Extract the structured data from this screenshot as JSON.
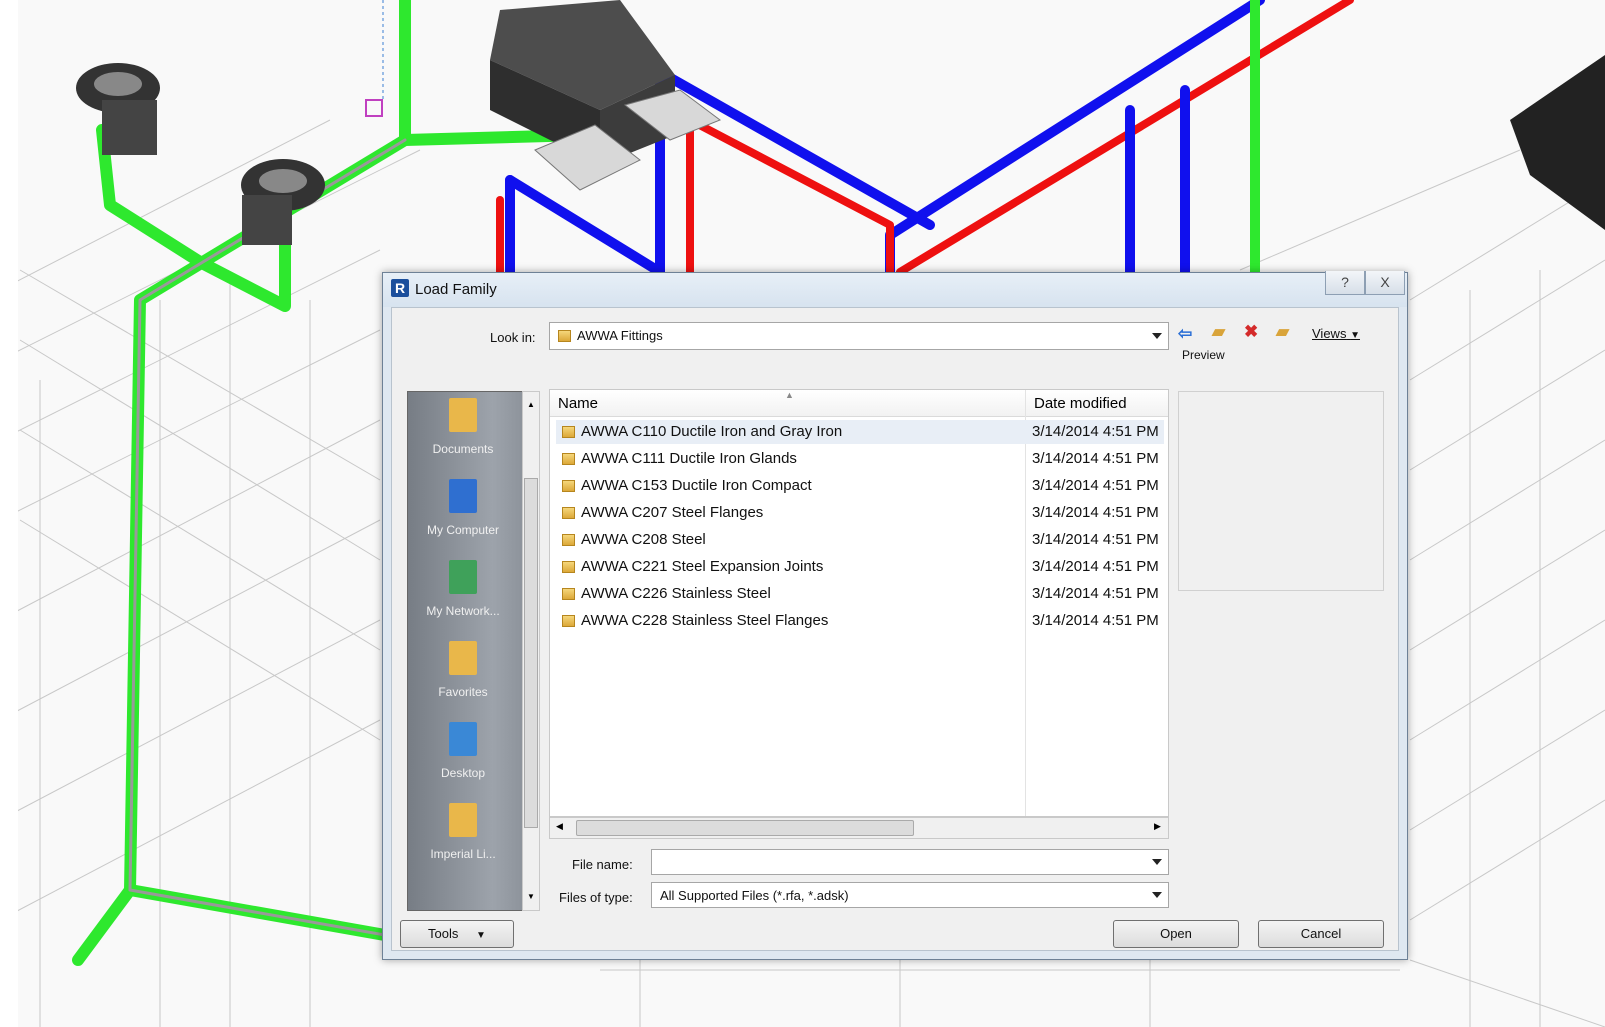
{
  "dialog": {
    "title": "Load Family",
    "help_glyph": "?",
    "close_glyph": "X",
    "look_in_label": "Look in:",
    "look_in_value": "AWWA Fittings",
    "toolbar": {
      "back_icon": "back-arrow-icon",
      "up_icon": "up-folder-icon",
      "delete_icon": "delete-icon",
      "new_folder_icon": "new-folder-icon",
      "views_label": "Views"
    },
    "preview_label": "Preview",
    "places": [
      {
        "label": "Documents",
        "icon": "documents-icon",
        "color": "#e9b74a"
      },
      {
        "label": "My Computer",
        "icon": "computer-icon",
        "color": "#2f6fd0"
      },
      {
        "label": "My Network...",
        "icon": "network-icon",
        "color": "#3fa15a"
      },
      {
        "label": "Favorites",
        "icon": "favorites-icon",
        "color": "#e9b74a"
      },
      {
        "label": "Desktop",
        "icon": "desktop-icon",
        "color": "#3a88d6"
      },
      {
        "label": "Imperial Li...",
        "icon": "library-folder-icon",
        "color": "#e9b74a"
      }
    ],
    "columns": {
      "name": "Name",
      "date": "Date modified"
    },
    "files": [
      {
        "name": "AWWA C110 Ductile Iron and Gray Iron",
        "date": "3/14/2014 4:51 PM"
      },
      {
        "name": "AWWA C111 Ductile Iron Glands",
        "date": "3/14/2014 4:51 PM"
      },
      {
        "name": "AWWA C153 Ductile Iron Compact",
        "date": "3/14/2014 4:51 PM"
      },
      {
        "name": "AWWA C207 Steel Flanges",
        "date": "3/14/2014 4:51 PM"
      },
      {
        "name": "AWWA C208 Steel",
        "date": "3/14/2014 4:51 PM"
      },
      {
        "name": "AWWA C221 Steel Expansion Joints",
        "date": "3/14/2014 4:51 PM"
      },
      {
        "name": "AWWA C226 Stainless Steel",
        "date": "3/14/2014 4:51 PM"
      },
      {
        "name": "AWWA C228 Stainless Steel Flanges",
        "date": "3/14/2014 4:51 PM"
      }
    ],
    "file_name_label": "File name:",
    "file_name_value": "",
    "file_type_label": "Files of type:",
    "file_type_value": "All Supported Files  (*.rfa, *.adsk)",
    "tools_label": "Tools",
    "open_label": "Open",
    "cancel_label": "Cancel"
  },
  "colors": {
    "pipe_green": "#2ee82e",
    "pipe_blue": "#1010ee",
    "pipe_red": "#ee1010"
  }
}
